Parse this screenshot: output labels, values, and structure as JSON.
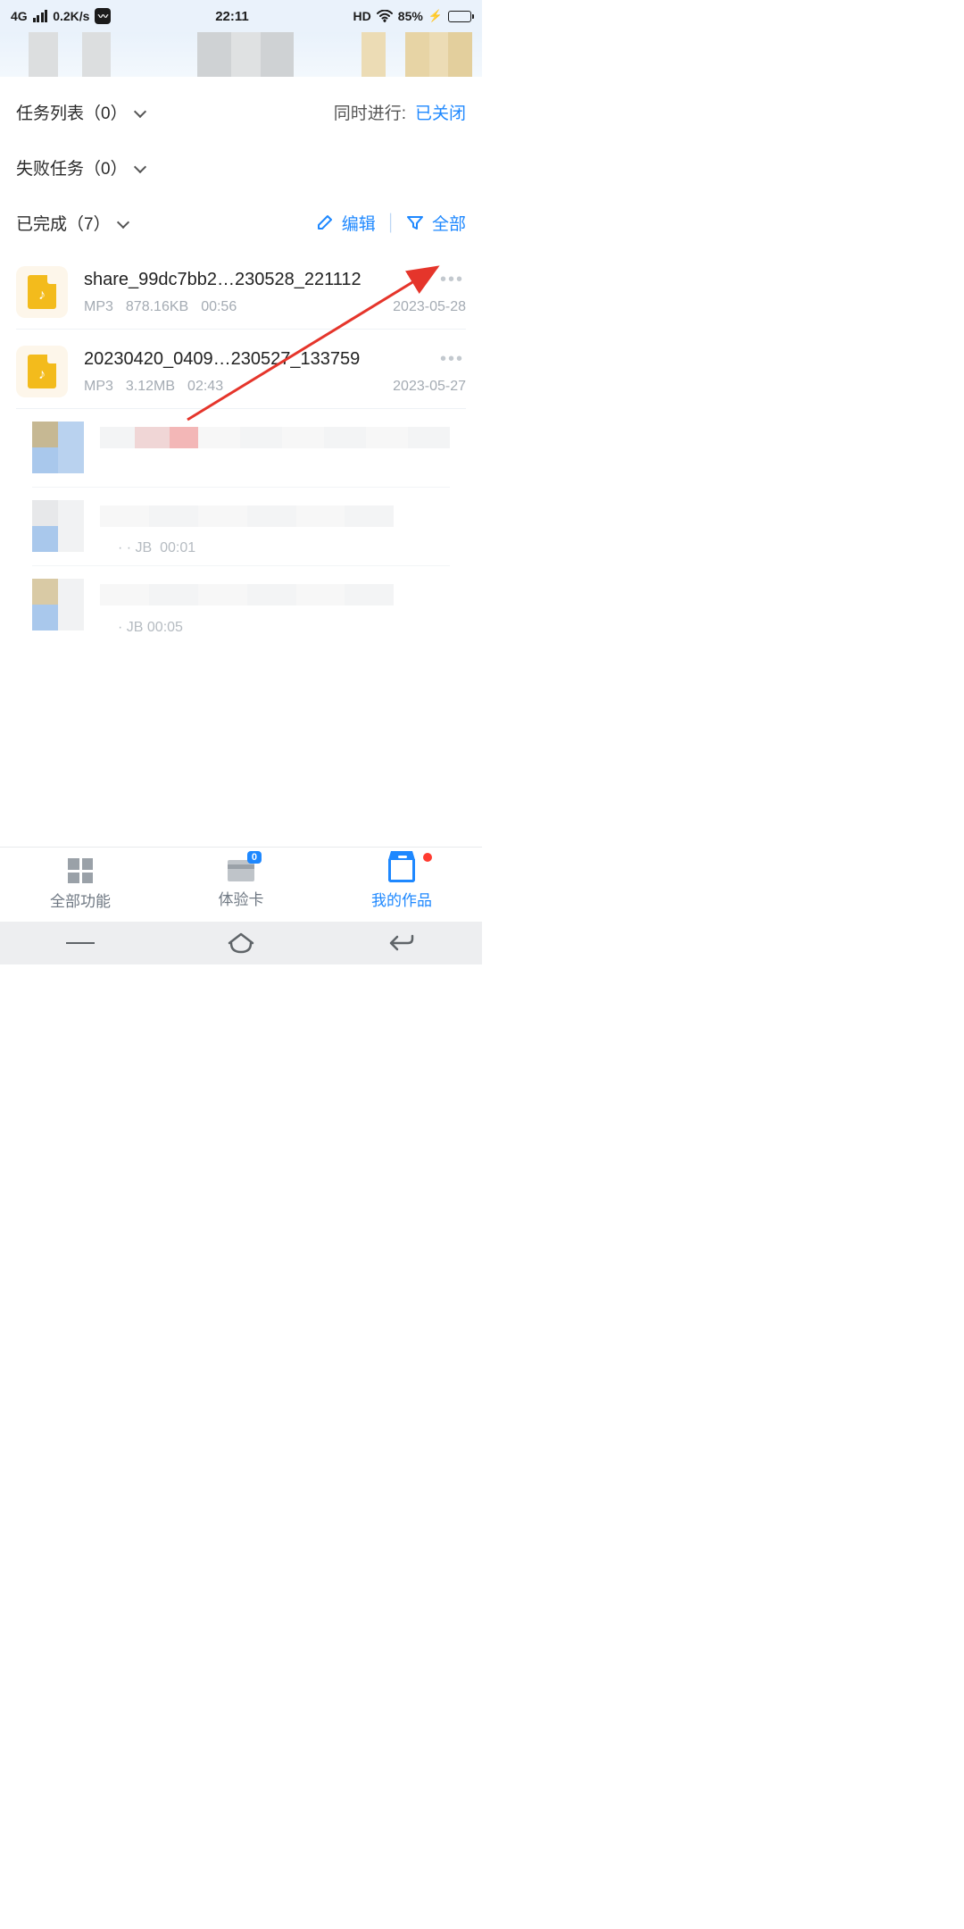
{
  "status": {
    "network": "4G",
    "speed": "0.2K/s",
    "time": "22:11",
    "hd": "HD",
    "battery_pct": "85%"
  },
  "sections": {
    "task_list": {
      "label": "任务列表（0）"
    },
    "task_right": {
      "label": "同时进行:",
      "value": "已关闭"
    },
    "failed": {
      "label": "失败任务（0）"
    },
    "done": {
      "label": "已完成（7）",
      "edit": "编辑",
      "filter": "全部"
    }
  },
  "files": [
    {
      "name": "share_99dc7bb2…230528_221112",
      "type": "MP3",
      "size": "878.16KB",
      "duration": "00:56",
      "date": "2023-05-28"
    },
    {
      "name": "20230420_0409…230527_133759",
      "type": "MP3",
      "size": "3.12MB",
      "duration": "02:43",
      "date": "2023-05-27"
    }
  ],
  "fragments": {
    "r0": "00:01",
    "r0_pre": "· · JB",
    "r1": "· JB  00:05"
  },
  "tabs": {
    "all": "全部功能",
    "card": "体验卡",
    "card_badge": "0",
    "mine": "我的作品"
  }
}
